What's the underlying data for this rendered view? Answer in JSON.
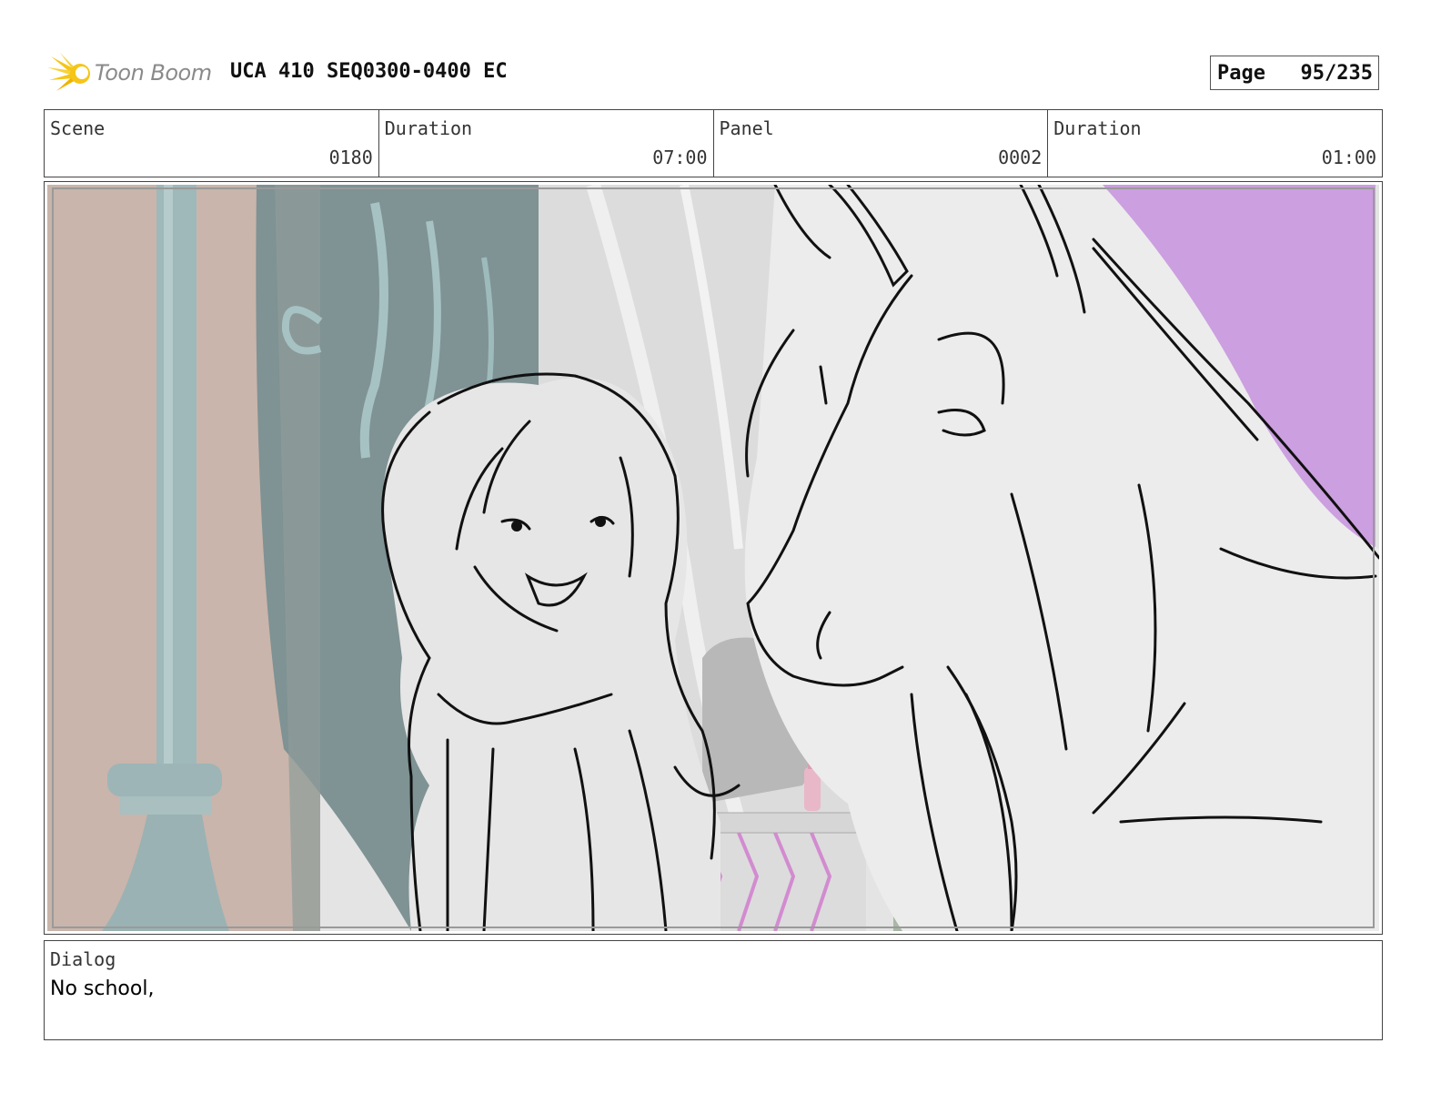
{
  "header": {
    "logo_text": "Toon Boom",
    "project_title": "UCA 410 SEQ0300-0400 EC",
    "page_label": "Page",
    "page_number": "95/235"
  },
  "info": {
    "scene_label": "Scene",
    "scene_value": "0180",
    "scene_duration_label": "Duration",
    "scene_duration_value": "07:00",
    "panel_label": "Panel",
    "panel_value": "0002",
    "panel_duration_label": "Duration",
    "panel_duration_value": "01:00"
  },
  "dialog": {
    "label": "Dialog",
    "text": "No school,"
  },
  "colors": {
    "logo_yellow": "#f5c518",
    "bg_purple": "#cc9fe0",
    "wall_pink": "#c9b3a9",
    "teal": "#93b4b6"
  }
}
